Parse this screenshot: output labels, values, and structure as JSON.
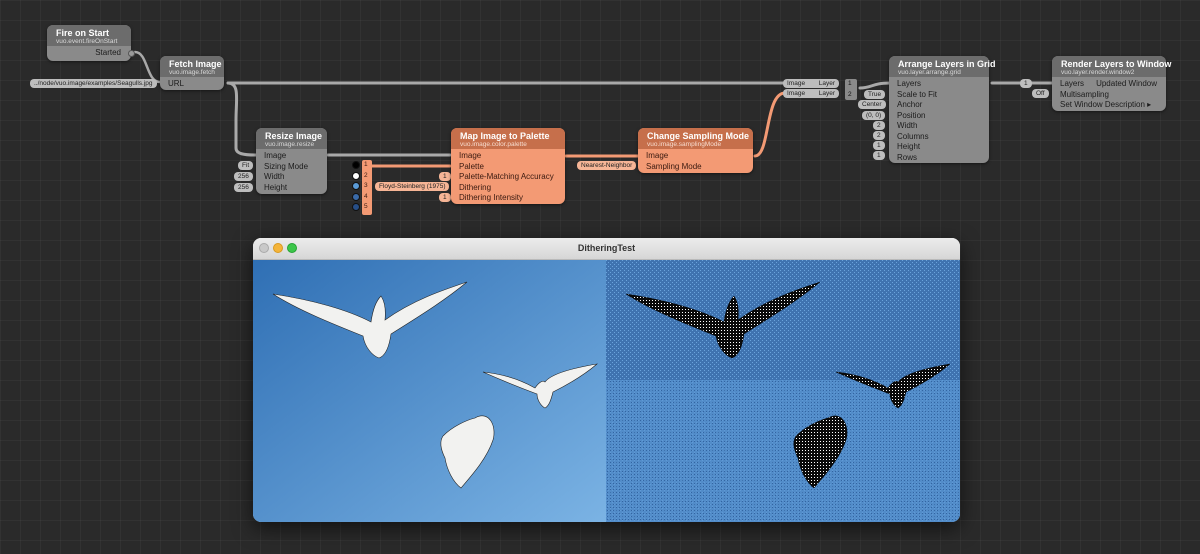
{
  "nodes": {
    "fire": {
      "title": "Fire on Start",
      "class": "vuo.event.fireOnStart",
      "outputs": [
        "Started"
      ]
    },
    "fetch": {
      "title": "Fetch Image",
      "class": "vuo.image.fetch",
      "inputs": [
        "URL"
      ],
      "url_value": "../node/vuo.image/examples/Seagulls.jpg"
    },
    "resize": {
      "title": "Resize Image",
      "class": "vuo.image.resize",
      "inputs": [
        "Image",
        "Sizing Mode",
        "Width",
        "Height"
      ],
      "constants": [
        "Fit",
        "256",
        "256"
      ]
    },
    "palette": {
      "title": "Map Image to Palette",
      "class": "vuo.image.color.palette",
      "inputs": [
        "Image",
        "Palette",
        "Palette-Matching Accuracy",
        "Dithering",
        "Dithering Intensity"
      ],
      "constants": [
        "1",
        "Floyd-Steinberg (1975)",
        "1"
      ]
    },
    "sampling": {
      "title": "Change Sampling Mode",
      "class": "vuo.image.samplingMode",
      "inputs": [
        "Image",
        "Sampling Mode"
      ],
      "constants": [
        "Nearest-Neighbor"
      ]
    },
    "grid": {
      "title": "Arrange Layers in Grid",
      "class": "vuo.layer.arrange.grid",
      "inputs": [
        "Layers",
        "Scale to Fit",
        "Anchor",
        "Position",
        "Width",
        "Columns",
        "Height",
        "Rows"
      ],
      "constants": [
        "True",
        "Center",
        "(0, 0)",
        "2",
        "2",
        "1",
        "1"
      ]
    },
    "render": {
      "title": "Render Layers to Window",
      "class": "vuo.layer.render.window2",
      "inputs": [
        "Layers",
        "Multisampling",
        "Set Window Description ▸"
      ],
      "outputs": [
        "Updated Window"
      ],
      "constants": [
        "1",
        "Off"
      ]
    }
  },
  "make_list": {
    "items": [
      "1",
      "2",
      "3",
      "4",
      "5"
    ],
    "colors": [
      "#000000",
      "#ffffff",
      "#5a9ad6",
      "#3a6aa8",
      "#274e86"
    ]
  },
  "layer_list": {
    "items": [
      "1",
      "2"
    ],
    "labels": [
      "Image",
      "Layer"
    ]
  },
  "window": {
    "title": "DitheringTest"
  }
}
